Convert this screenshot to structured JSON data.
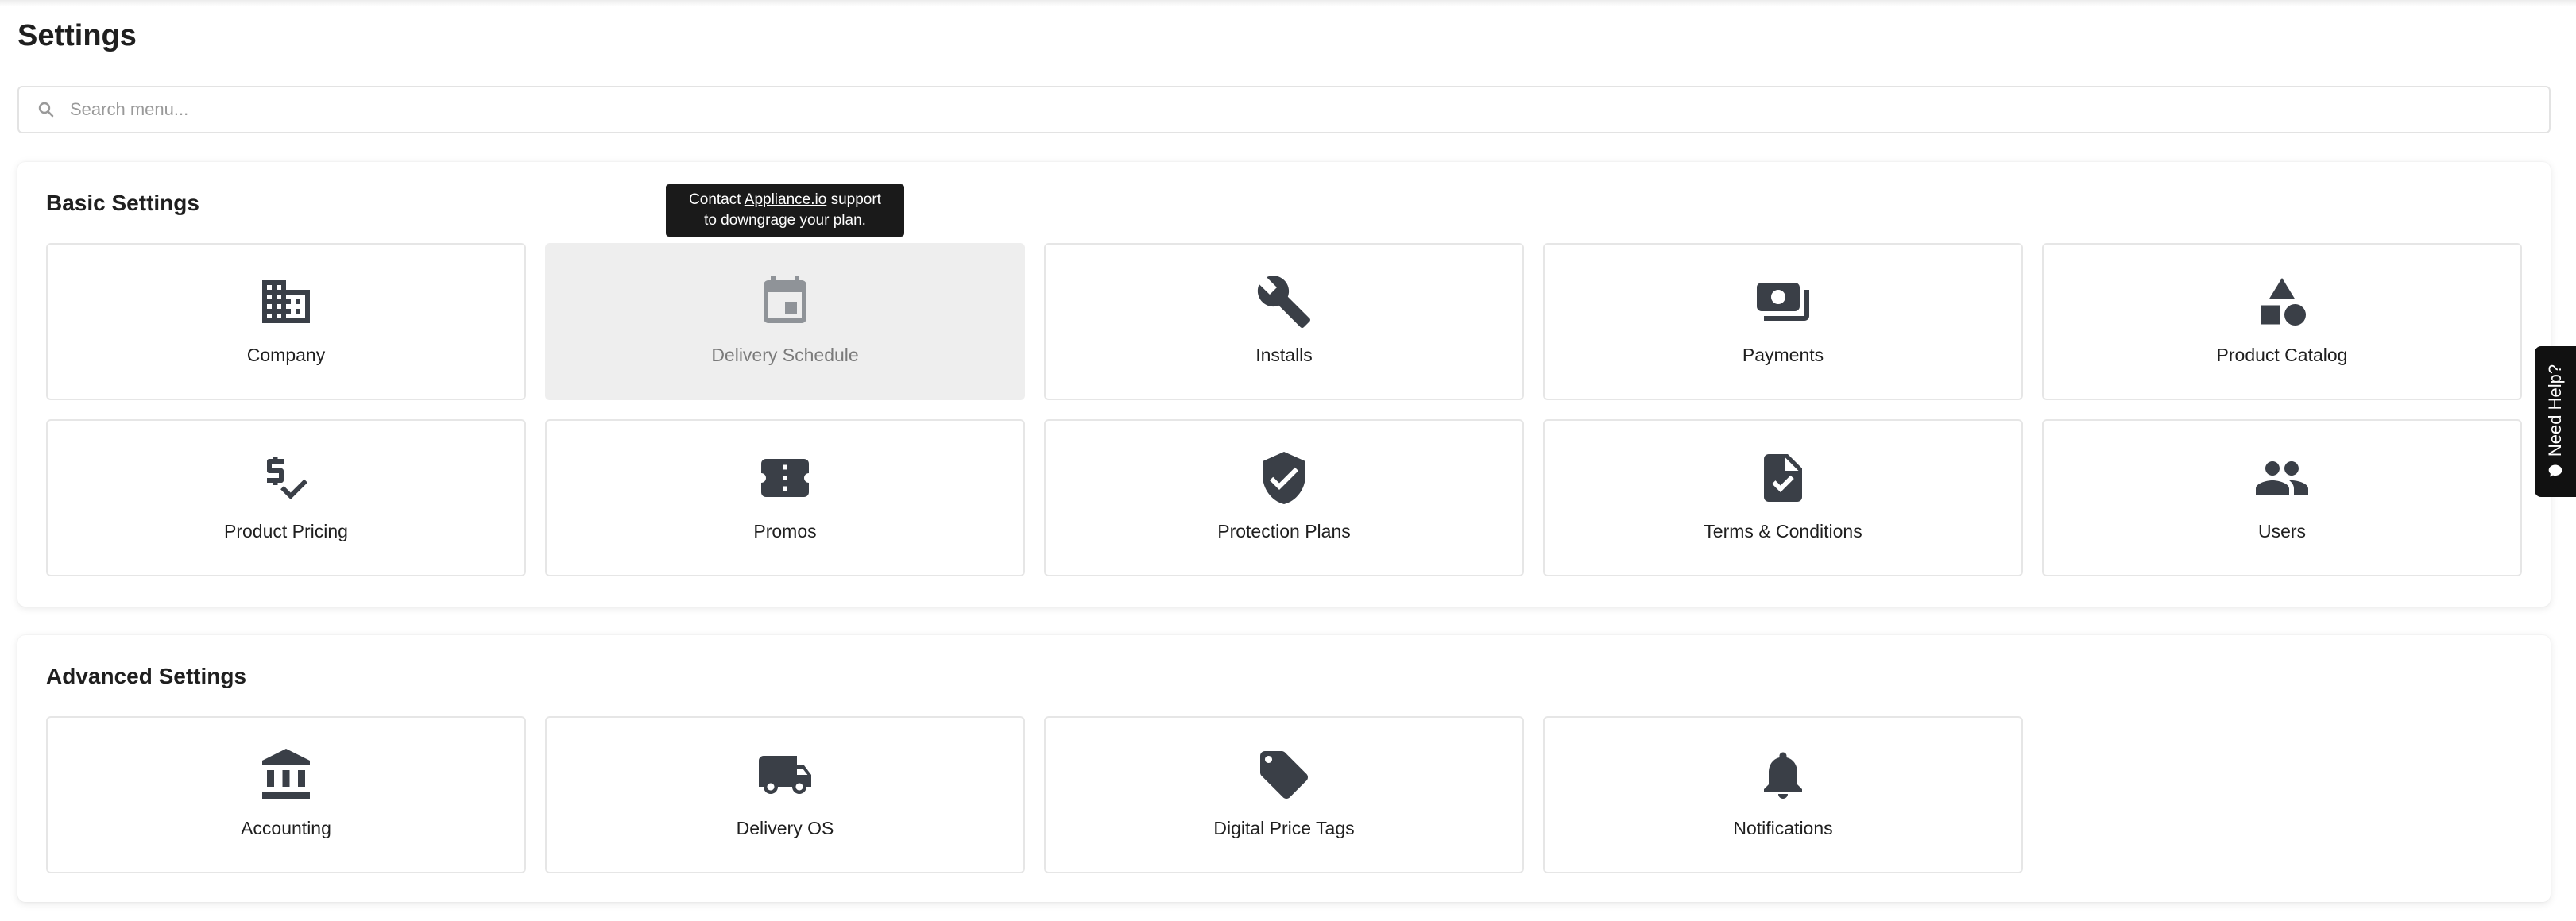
{
  "page": {
    "title": "Settings"
  },
  "search": {
    "placeholder": "Search menu..."
  },
  "basic": {
    "title": "Basic Settings",
    "tiles": [
      {
        "label": "Company",
        "icon": "building-icon"
      },
      {
        "label": "Delivery Schedule",
        "icon": "calendar-icon",
        "disabled": true
      },
      {
        "label": "Installs",
        "icon": "wrench-icon"
      },
      {
        "label": "Payments",
        "icon": "payments-icon"
      },
      {
        "label": "Product Catalog",
        "icon": "shapes-icon"
      },
      {
        "label": "Product Pricing",
        "icon": "price-check-icon"
      },
      {
        "label": "Promos",
        "icon": "ticket-icon"
      },
      {
        "label": "Protection Plans",
        "icon": "shield-check-icon"
      },
      {
        "label": "Terms & Conditions",
        "icon": "document-check-icon"
      },
      {
        "label": "Users",
        "icon": "users-icon"
      }
    ]
  },
  "tooltip": {
    "prefix": "Contact ",
    "link": "Appliance.io",
    "suffix": " support",
    "line2": "to downgrage your plan."
  },
  "advanced": {
    "title": "Advanced Settings",
    "tiles": [
      {
        "label": "Accounting",
        "icon": "bank-icon"
      },
      {
        "label": "Delivery OS",
        "icon": "truck-icon"
      },
      {
        "label": "Digital Price Tags",
        "icon": "tag-icon"
      },
      {
        "label": "Notifications",
        "icon": "bell-icon"
      }
    ]
  },
  "help": {
    "label": "Need Help?",
    "icon": "chat-bubble-icon"
  },
  "colors": {
    "icon": "#3a3f47",
    "disabled_bg": "#eeeeee",
    "tooltip_bg": "#1a1a1a"
  }
}
